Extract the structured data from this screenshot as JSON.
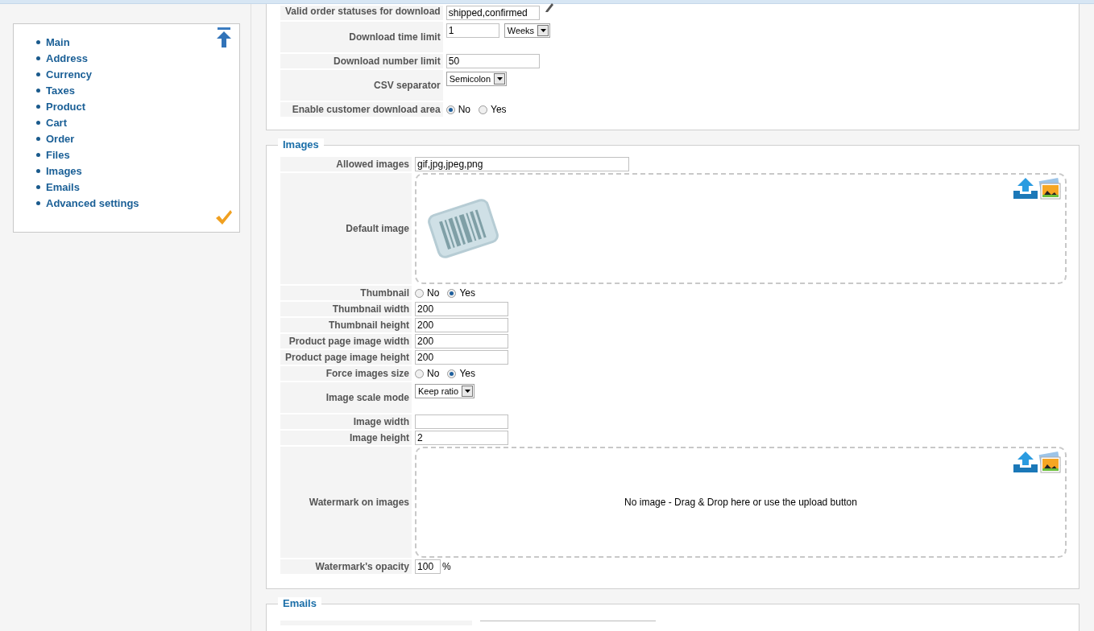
{
  "sidebar": {
    "items": [
      {
        "label": "Main"
      },
      {
        "label": "Address"
      },
      {
        "label": "Currency"
      },
      {
        "label": "Taxes"
      },
      {
        "label": "Product"
      },
      {
        "label": "Cart"
      },
      {
        "label": "Order"
      },
      {
        "label": "Files"
      },
      {
        "label": "Images"
      },
      {
        "label": "Emails"
      },
      {
        "label": "Advanced settings"
      }
    ]
  },
  "sections": [
    {
      "rows": [
        {
          "kind": "text_edit",
          "label": "Valid order statuses for download",
          "value": "shipped,confirmed"
        },
        {
          "kind": "text_select",
          "label": "Download time limit",
          "value": "1",
          "select": "Weeks"
        },
        {
          "kind": "text",
          "label": "Download number limit",
          "value": "50"
        },
        {
          "kind": "select",
          "label": "CSV separator",
          "select": "Semicolon"
        },
        {
          "kind": "radio",
          "label": "Enable customer download area",
          "options": [
            {
              "label": "No",
              "selected": true
            },
            {
              "label": "Yes",
              "selected": false
            }
          ]
        }
      ]
    },
    {
      "legend": "Images",
      "rows": [
        {
          "kind": "text_wide",
          "label": "Allowed images",
          "value": "gif,jpg,jpeg,png"
        },
        {
          "kind": "dropzone",
          "label": "Default image",
          "has_image": true
        },
        {
          "kind": "radio",
          "label": "Thumbnail",
          "options": [
            {
              "label": "No",
              "selected": false
            },
            {
              "label": "Yes",
              "selected": true
            }
          ]
        },
        {
          "kind": "text",
          "label": "Thumbnail width",
          "value": "200"
        },
        {
          "kind": "text",
          "label": "Thumbnail height",
          "value": "200"
        },
        {
          "kind": "text",
          "label": "Product page image width",
          "value": "200"
        },
        {
          "kind": "text",
          "label": "Product page image height",
          "value": "200"
        },
        {
          "kind": "radio",
          "label": "Force images size",
          "options": [
            {
              "label": "No",
              "selected": false
            },
            {
              "label": "Yes",
              "selected": true
            }
          ]
        },
        {
          "kind": "select",
          "label": "Image scale mode",
          "select": "Keep ratio"
        },
        {
          "kind": "text",
          "label": "Image width",
          "value": ""
        },
        {
          "kind": "text",
          "label": "Image height",
          "value": "2"
        },
        {
          "kind": "dropzone",
          "label": "Watermark on images",
          "has_image": false,
          "message": "No image - Drag & Drop here or use the upload button"
        },
        {
          "kind": "text_small",
          "label": "Watermark's opacity",
          "value": "100",
          "suffix": "%"
        }
      ]
    },
    {
      "legend": "Emails"
    }
  ]
}
